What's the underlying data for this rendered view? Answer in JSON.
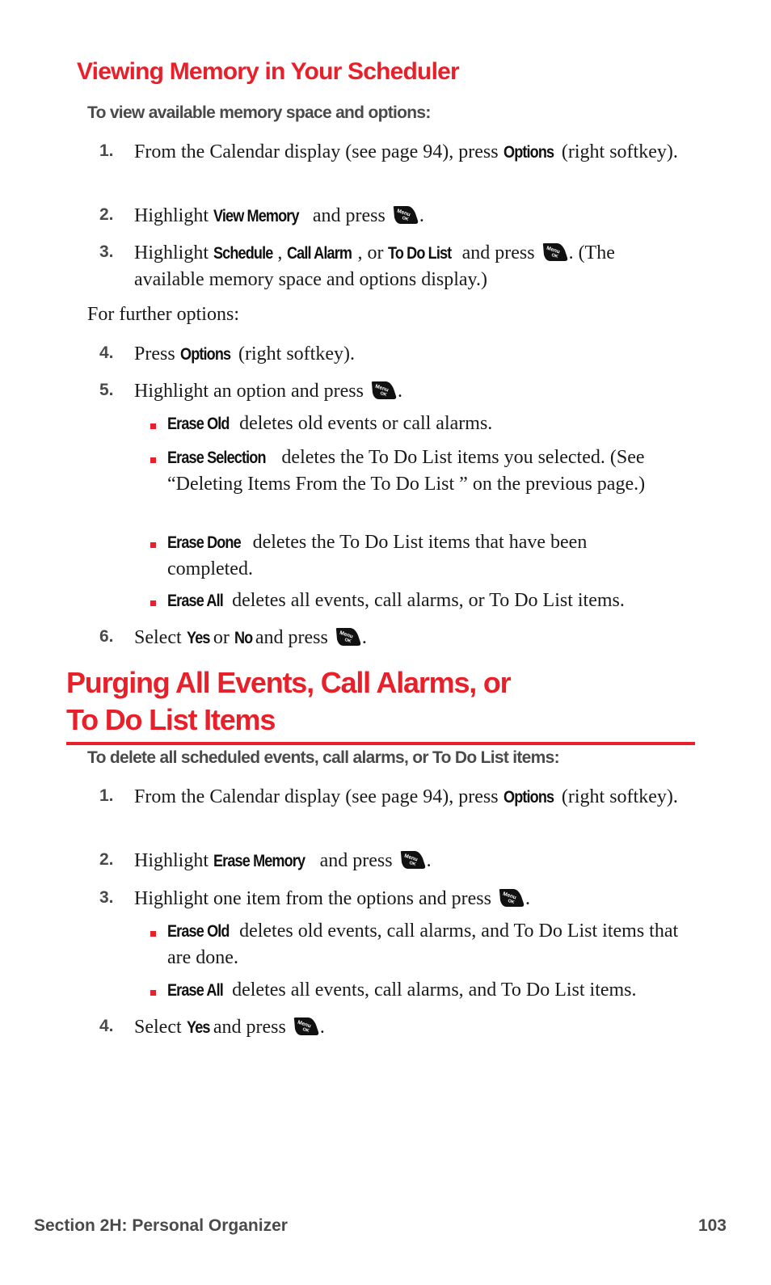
{
  "section1": {
    "title": "Viewing Memory in Your Scheduler",
    "intro": "To view available memory space and options:",
    "steps": [
      {
        "num": "1.",
        "parts": [
          "From the Calendar display (see page 94), press ",
          "Options",
          " (right softkey)."
        ]
      },
      {
        "num": "2.",
        "parts": [
          "Highlight ",
          "View Memory",
          " and press ",
          "."
        ]
      },
      {
        "num": "3.",
        "parts": [
          "Highlight ",
          "Schedule",
          ", ",
          "Call Alarm",
          ", or ",
          "To Do List",
          " and press ",
          ". (The available memory space and options display.)"
        ]
      }
    ],
    "further": "For further options:",
    "steps2": [
      {
        "num": "4.",
        "parts": [
          "Press ",
          "Options",
          " (right softkey)."
        ]
      },
      {
        "num": "5.",
        "parts": [
          "Highlight an option and press ",
          "."
        ]
      },
      {
        "num": "6.",
        "parts": [
          "Select ",
          "Yes",
          " or ",
          "No",
          " and press ",
          "."
        ]
      }
    ],
    "bullets": [
      {
        "keyword": "Erase Old",
        "text": " deletes old events or call alarms."
      },
      {
        "keyword": "Erase Selection",
        "text": " deletes the To Do List items you selected. (See “Deleting Items From the To Do List ” on the previous page.)"
      },
      {
        "keyword": "Erase Done",
        "text": " deletes the To Do List items that have been completed."
      },
      {
        "keyword": "Erase All",
        "text": " deletes all events, call alarms, or To Do List items."
      }
    ]
  },
  "section2": {
    "title_line1": "Purging All Events, Call Alarms, or",
    "title_line2": "To Do List Items",
    "intro": "To delete all scheduled events, call alarms, or To Do List items:",
    "steps": [
      {
        "num": "1.",
        "parts": [
          "From the Calendar display (see page 94), press ",
          "Options",
          " (right softkey)."
        ]
      },
      {
        "num": "2.",
        "parts": [
          "Highlight ",
          "Erase Memory",
          " and press ",
          "."
        ]
      },
      {
        "num": "3.",
        "parts": [
          "Highlight one item from the options and press ",
          "."
        ]
      },
      {
        "num": "4.",
        "parts": [
          "Select ",
          "Yes",
          " and press ",
          "."
        ]
      }
    ],
    "bullets": [
      {
        "keyword": "Erase Old",
        "text": " deletes old events, call alarms, and To Do List items that are done."
      },
      {
        "keyword": "Erase All",
        "text": " deletes all events, call alarms, and To Do List items."
      }
    ]
  },
  "icons": {
    "menu_ok_key": "menu-ok-key-icon",
    "menu_ok_label_top": "Menu",
    "menu_ok_label_bottom": "OK"
  },
  "footer": {
    "section": "Section 2H: Personal Organizer",
    "page_number": "103"
  },
  "colors": {
    "accent": "#e8202a",
    "subhead": "#4a4a4a",
    "body": "#1a1a1a"
  }
}
